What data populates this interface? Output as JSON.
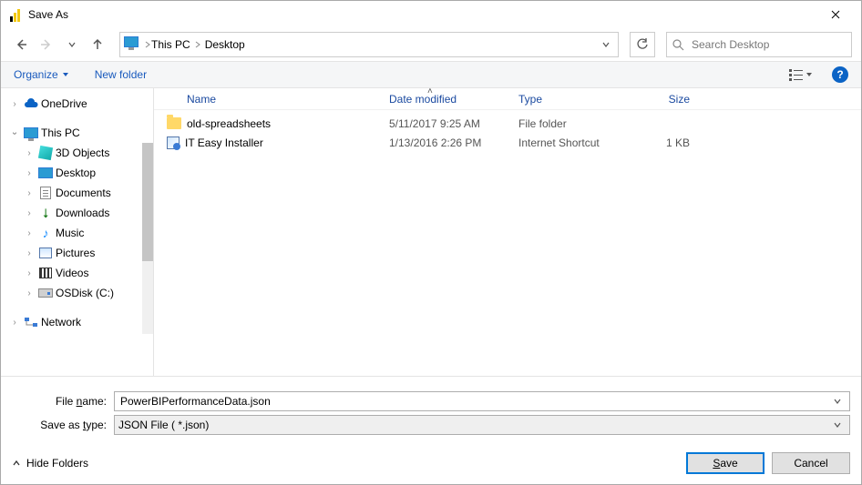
{
  "title": "Save As",
  "breadcrumb": {
    "root": "This PC",
    "current": "Desktop"
  },
  "search_placeholder": "Search Desktop",
  "toolbar": {
    "organize": "Organize",
    "new_folder": "New folder"
  },
  "columns": {
    "name": "Name",
    "date": "Date modified",
    "type": "Type",
    "size": "Size"
  },
  "tree": {
    "onedrive": "OneDrive",
    "thispc": "This PC",
    "objects3d": "3D Objects",
    "desktop": "Desktop",
    "documents": "Documents",
    "downloads": "Downloads",
    "music": "Music",
    "pictures": "Pictures",
    "videos": "Videos",
    "osdisk": "OSDisk (C:)",
    "network": "Network"
  },
  "files": [
    {
      "name": "old-spreadsheets",
      "date": "5/11/2017 9:25 AM",
      "type": "File folder",
      "size": ""
    },
    {
      "name": "IT Easy Installer",
      "date": "1/13/2016 2:26 PM",
      "type": "Internet Shortcut",
      "size": "1 KB"
    }
  ],
  "filename_label": "File name:",
  "filetype_label": "Save as type:",
  "filename_value": "PowerBIPerformanceData.json",
  "filetype_value": "JSON File  ( *.json)",
  "hide_folders": "Hide Folders",
  "save_label": "Save",
  "cancel_label": "Cancel",
  "help_char": "?"
}
